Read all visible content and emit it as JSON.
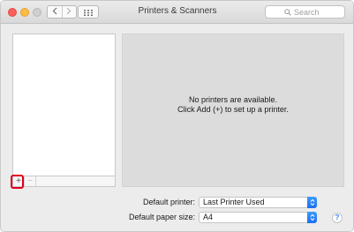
{
  "window": {
    "title": "Printers & Scanners"
  },
  "toolbar": {
    "back_icon": "chevron-left-icon",
    "forward_icon": "chevron-right-icon",
    "grid_icon": "grid-icon",
    "search": {
      "placeholder": "Search",
      "icon": "search-icon"
    }
  },
  "printers": {
    "items": [],
    "add_label": "+",
    "remove_label": "−"
  },
  "detail": {
    "empty_line1": "No printers are available.",
    "empty_line2": "Click Add (+) to set up a printer."
  },
  "settings": {
    "default_printer_label": "Default printer:",
    "default_printer_value": "Last Printer Used",
    "paper_size_label": "Default paper size:",
    "paper_size_value": "A4"
  },
  "help": {
    "label": "?"
  },
  "colors": {
    "traffic_close": "#fc605c",
    "traffic_minimize": "#fdbc40",
    "traffic_zoom": "#cfcfcf",
    "highlight": "#e0001b",
    "accent": "#1a6ff2"
  }
}
